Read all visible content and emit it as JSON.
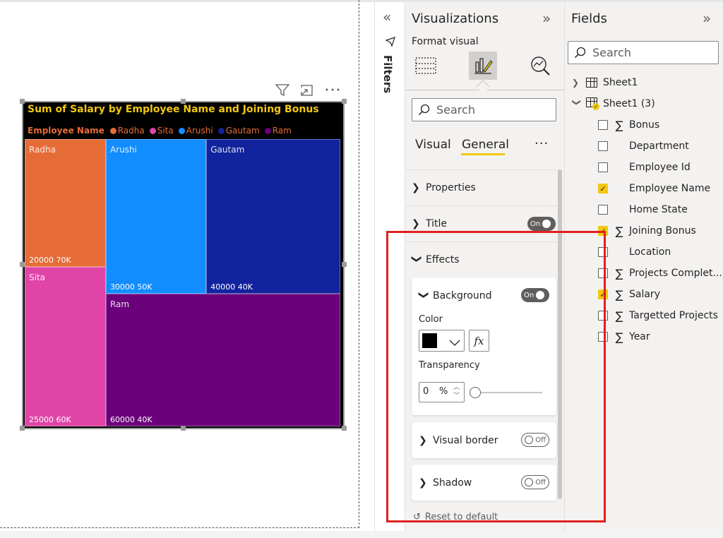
{
  "canvas": {
    "visual": {
      "title": "Sum of Salary by Employee Name and Joining Bonus",
      "legend": {
        "title": "Employee Name",
        "items": [
          {
            "label": "Radha",
            "color": "#e66c37"
          },
          {
            "label": "Sita",
            "color": "#e044a7"
          },
          {
            "label": "Arushi",
            "color": "#118dff"
          },
          {
            "label": "Gautam",
            "color": "#12239e"
          },
          {
            "label": "Ram",
            "color": "#6b007b"
          }
        ]
      },
      "header_icons": [
        "filter-icon",
        "focus-mode-icon",
        "more-options-icon"
      ]
    }
  },
  "chart_data": {
    "type": "treemap",
    "title": "Sum of Salary by Employee Name and Joining Bonus",
    "legend_title": "Employee Name",
    "items": [
      {
        "name": "Radha",
        "salary": 20000,
        "joining_bonus": "70K",
        "label": "20000 70K",
        "color": "#e66c37"
      },
      {
        "name": "Sita",
        "salary": 25000,
        "joining_bonus": "60K",
        "label": "25000 60K",
        "color": "#e044a7"
      },
      {
        "name": "Arushi",
        "salary": 30000,
        "joining_bonus": "50K",
        "label": "30000 50K",
        "color": "#118dff"
      },
      {
        "name": "Gautam",
        "salary": 40000,
        "joining_bonus": "40K",
        "label": "40000 40K",
        "color": "#12239e"
      },
      {
        "name": "Ram",
        "salary": 60000,
        "joining_bonus": "40K",
        "label": "60000 40K",
        "color": "#6b007b"
      }
    ]
  },
  "filters": {
    "label": "Filters"
  },
  "visualizations": {
    "title": "Visualizations",
    "subtitle": "Format visual",
    "search_placeholder": "Search",
    "tabs": [
      "Visual",
      "General"
    ],
    "active_tab": "General",
    "sections": {
      "properties": "Properties",
      "title": "Title",
      "title_toggle": "On",
      "effects": "Effects"
    },
    "background": {
      "label": "Background",
      "toggle": "On",
      "color_label": "Color",
      "color_value": "#000000",
      "fx_label": "fx",
      "transparency_label": "Transparency",
      "transparency_value": "0",
      "transparency_unit": "%",
      "transparency_fraction": 0
    },
    "visual_border": {
      "label": "Visual border",
      "toggle": "Off"
    },
    "shadow": {
      "label": "Shadow",
      "toggle": "Off"
    },
    "reset": "Reset to default"
  },
  "fields": {
    "title": "Fields",
    "search_placeholder": "Search",
    "tables": [
      {
        "name": "Sheet1",
        "expanded": false
      },
      {
        "name": "Sheet1 (3)",
        "expanded": true
      }
    ],
    "items": [
      {
        "name": "Bonus",
        "sigma": true,
        "checked": false
      },
      {
        "name": "Department",
        "sigma": false,
        "checked": false
      },
      {
        "name": "Employee Id",
        "sigma": false,
        "checked": false
      },
      {
        "name": "Employee Name",
        "sigma": false,
        "checked": true
      },
      {
        "name": "Home State",
        "sigma": false,
        "checked": false
      },
      {
        "name": "Joining Bonus",
        "sigma": true,
        "checked": true
      },
      {
        "name": "Location",
        "sigma": false,
        "checked": false
      },
      {
        "name": "Projects Complet...",
        "sigma": true,
        "checked": false
      },
      {
        "name": "Salary",
        "sigma": true,
        "checked": true
      },
      {
        "name": "Targetted Projects",
        "sigma": true,
        "checked": false
      },
      {
        "name": "Year",
        "sigma": true,
        "checked": false
      }
    ]
  },
  "colors": {
    "accent": "#f2c811",
    "highlight": "#e02020"
  }
}
